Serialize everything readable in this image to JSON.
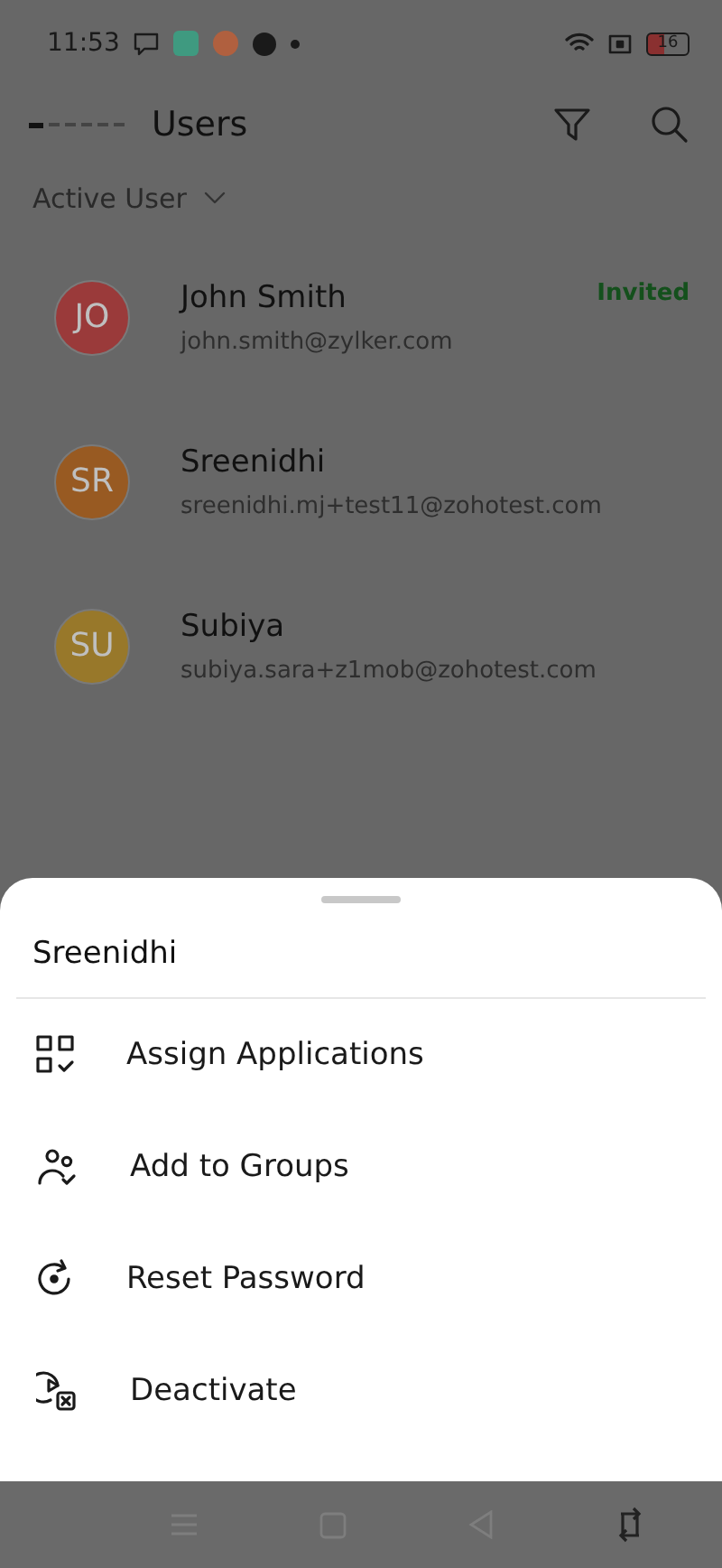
{
  "status_bar": {
    "time": "11:53",
    "battery": "16"
  },
  "header": {
    "title": "Users"
  },
  "filter": {
    "label": "Active User"
  },
  "users": [
    {
      "initials": "JO",
      "name": "John Smith",
      "email": "john.smith@zylker.com",
      "color": "#9a3a3a",
      "badge": "Invited"
    },
    {
      "initials": "SR",
      "name": "Sreenidhi",
      "email": "sreenidhi.mj+test11@zohotest.com",
      "color": "#985a22"
    },
    {
      "initials": "SU",
      "name": "Subiya",
      "email": "subiya.sara+z1mob@zohotest.com",
      "color": "#98782a"
    }
  ],
  "sheet": {
    "title": "Sreenidhi",
    "actions": [
      {
        "label": "Assign Applications",
        "kind": "apps"
      },
      {
        "label": "Add to Groups",
        "kind": "groups"
      },
      {
        "label": "Reset Password",
        "kind": "reset"
      },
      {
        "label": "Deactivate",
        "kind": "deactivate"
      }
    ]
  }
}
